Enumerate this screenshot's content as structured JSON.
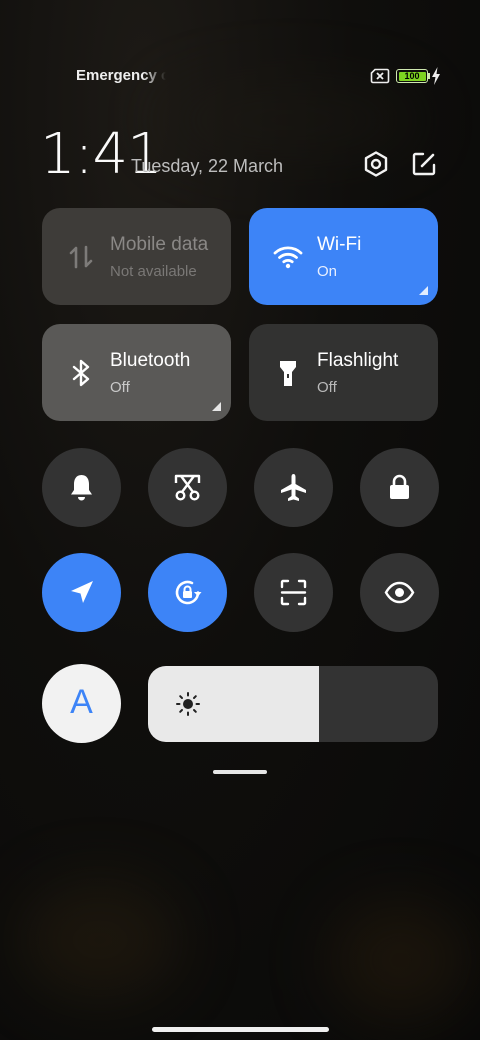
{
  "status_bar": {
    "carrier": "Emergency calls only",
    "battery_level": "100"
  },
  "header": {
    "time": "1:41",
    "date": "Tuesday, 22 March"
  },
  "tiles": {
    "mobile_data": {
      "name": "Mobile data",
      "state": "Not available"
    },
    "wifi": {
      "name": "Wi-Fi",
      "state": "On"
    },
    "bluetooth": {
      "name": "Bluetooth",
      "state": "Off"
    },
    "flashlight": {
      "name": "Flashlight",
      "state": "Off"
    }
  },
  "toggles": [
    {
      "icon": "bell-icon",
      "active": false
    },
    {
      "icon": "screenshot-scissors-icon",
      "active": false
    },
    {
      "icon": "airplane-icon",
      "active": false
    },
    {
      "icon": "lock-icon",
      "active": false
    },
    {
      "icon": "location-arrow-icon",
      "active": true
    },
    {
      "icon": "rotation-lock-icon",
      "active": true
    },
    {
      "icon": "scan-frame-icon",
      "active": false
    },
    {
      "icon": "eye-icon",
      "active": false
    }
  ],
  "auto_brightness_label": "A",
  "brightness": {
    "level": 0.59
  },
  "colors": {
    "accent": "#3d84f7",
    "tile_dark": "#323231",
    "battery": "#7ed321"
  }
}
